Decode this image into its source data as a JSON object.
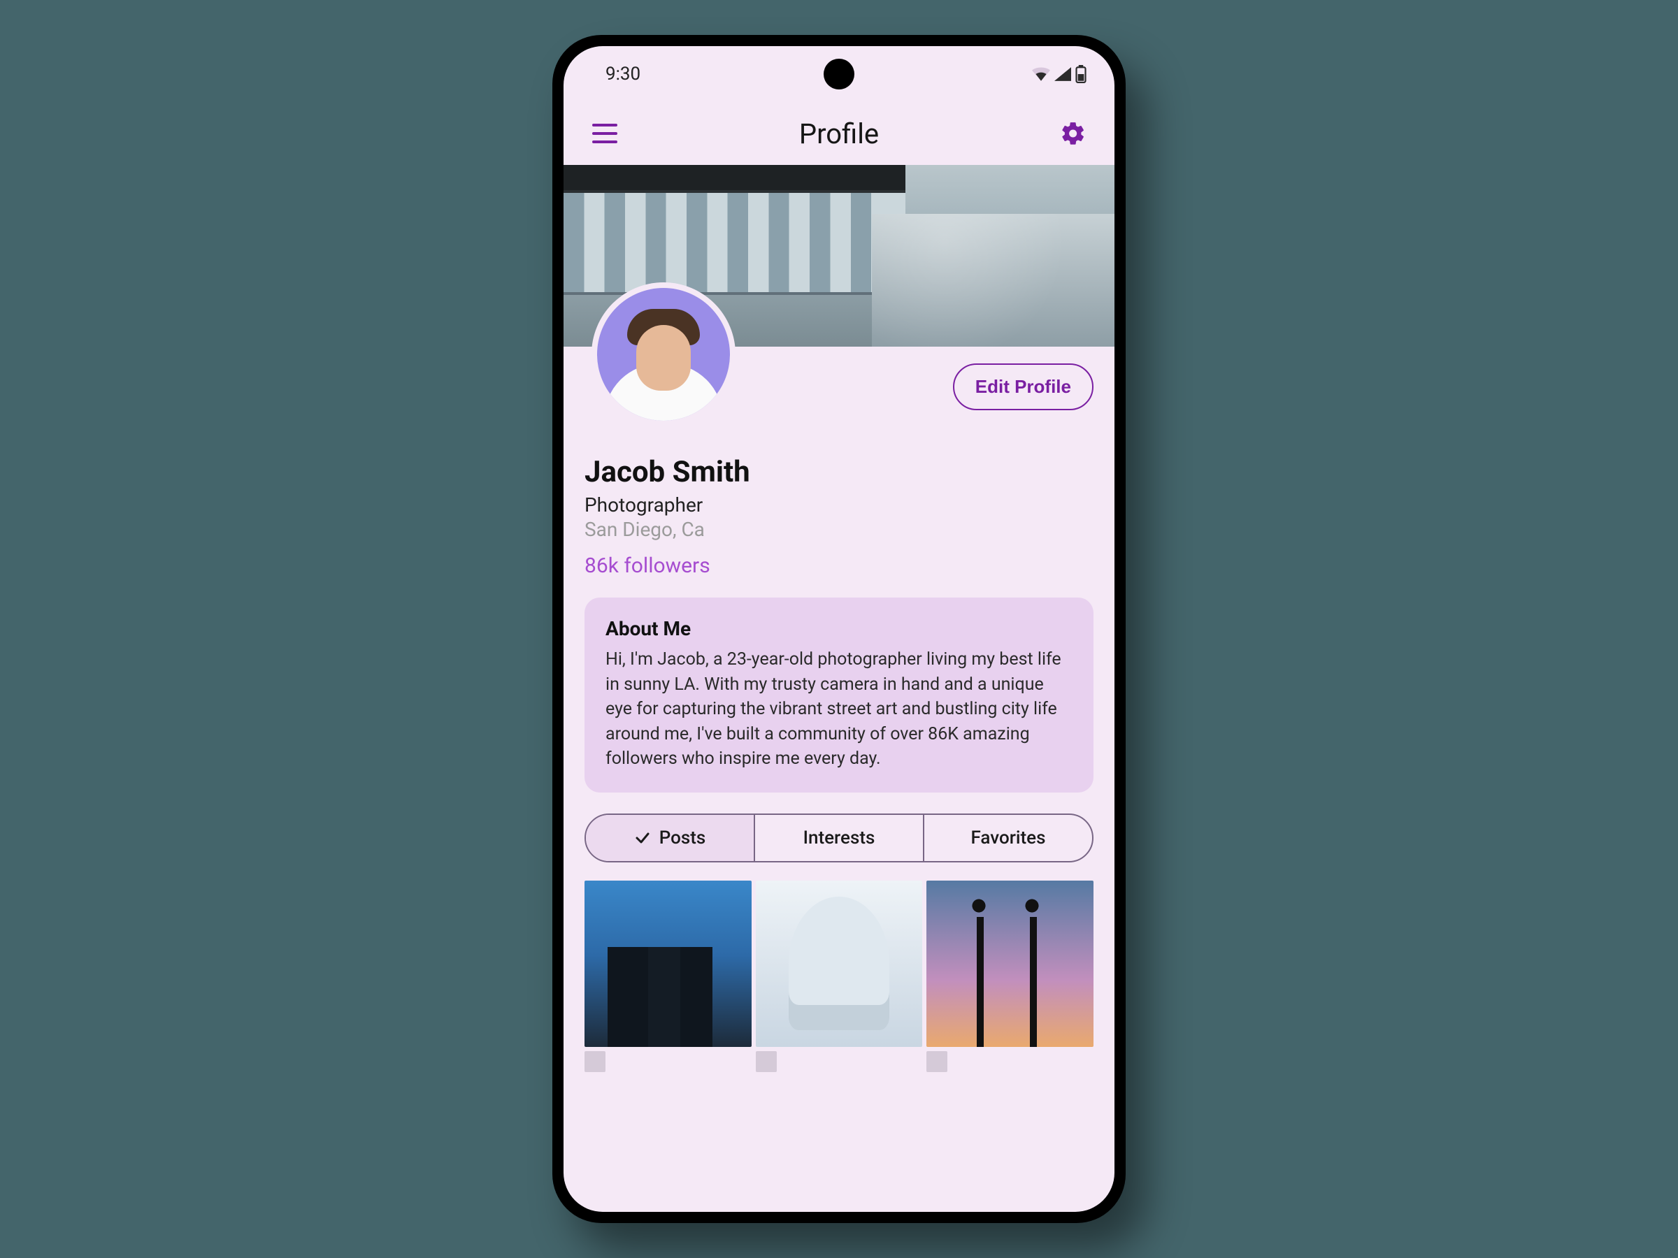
{
  "status": {
    "time": "9:30"
  },
  "appbar": {
    "title": "Profile"
  },
  "actions": {
    "edit_profile": "Edit Profile"
  },
  "profile": {
    "name": "Jacob Smith",
    "role": "Photographer",
    "location": "San Diego, Ca",
    "followers": "86k followers"
  },
  "about": {
    "title": "About Me",
    "body": "Hi, I'm Jacob, a 23-year-old photographer living my best life in sunny LA. With my trusty camera in hand and a unique eye for capturing the vibrant street art and bustling city life around me, I've built a community of over 86K amazing followers who inspire me every day."
  },
  "tabs": {
    "posts": "Posts",
    "interests": "Interests",
    "favorites": "Favorites",
    "active": "posts"
  },
  "colors": {
    "accent": "#7a1fa2",
    "link": "#a64dd0",
    "surface": "#f5e9f6",
    "card": "#e8d1ef"
  }
}
